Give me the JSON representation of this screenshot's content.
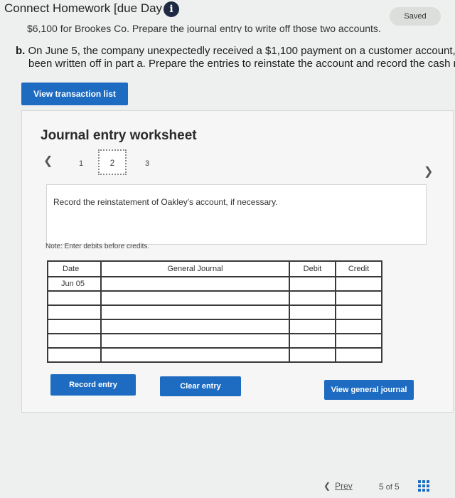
{
  "header": {
    "title": "Connect Homework [due Day 7]",
    "info_icon": "i",
    "saved": "Saved"
  },
  "question": {
    "cut_line": "$6,100 for Brookes Co. Prepare the journal entry to write off those two accounts.",
    "b_letter": "b.",
    "b_line1": "On June 5, the company unexpectedly received a $1,100 payment on a customer account, ",
    "b_line2": "been written off in part a. Prepare the entries to reinstate the account and record the cash r"
  },
  "buttons": {
    "view_transaction_list": "View transaction list",
    "record_entry": "Record entry",
    "clear_entry": "Clear entry",
    "view_general_journal": "View general journal"
  },
  "worksheet": {
    "title": "Journal entry worksheet",
    "steps": [
      "1",
      "2",
      "3"
    ],
    "active_step": "2",
    "instruction": "Record the reinstatement of Oakley's account, if necessary.",
    "note": "Note: Enter debits before credits."
  },
  "table": {
    "headers": {
      "date": "Date",
      "general_journal": "General Journal",
      "debit": "Debit",
      "credit": "Credit"
    },
    "rows": [
      {
        "date": "Jun 05",
        "account": "",
        "debit": "",
        "credit": ""
      },
      {
        "date": "",
        "account": "",
        "debit": "",
        "credit": ""
      },
      {
        "date": "",
        "account": "",
        "debit": "",
        "credit": ""
      },
      {
        "date": "",
        "account": "",
        "debit": "",
        "credit": ""
      },
      {
        "date": "",
        "account": "",
        "debit": "",
        "credit": ""
      },
      {
        "date": "",
        "account": "",
        "debit": "",
        "credit": ""
      }
    ]
  },
  "footer": {
    "prev": "Prev",
    "page_current": "5",
    "page_of": "of",
    "page_total": "5"
  },
  "colors": {
    "accent": "#1d6cc2",
    "info_icon_bg": "#1e2a44"
  }
}
